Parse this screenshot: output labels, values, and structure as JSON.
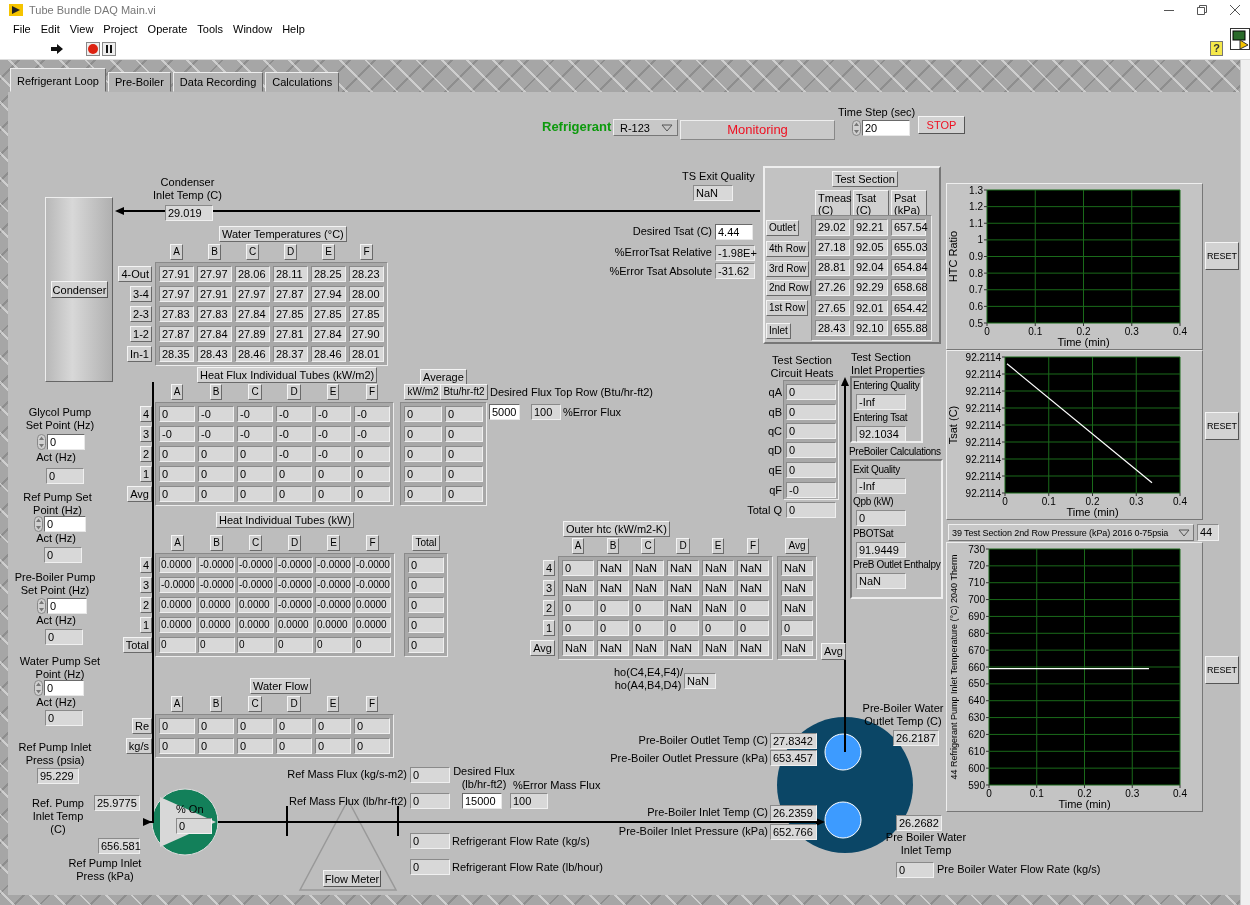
{
  "window": {
    "title": "Tube Bundle DAQ Main.vi"
  },
  "menu": [
    "File",
    "Edit",
    "View",
    "Project",
    "Operate",
    "Tools",
    "Window",
    "Help"
  ],
  "toolbar": {
    "help": "?"
  },
  "tabs": [
    {
      "label": "Refrigerant Loop",
      "selected": true
    },
    {
      "label": "Pre-Boiler",
      "selected": false
    },
    {
      "label": "Data Recording",
      "selected": false
    },
    {
      "label": "Calculations",
      "selected": false
    }
  ],
  "header": {
    "refrigerant_label": "Refrigerant",
    "refrigerant": "R-123",
    "status": "Monitoring",
    "stop_button": "STOP"
  },
  "fields": [
    {
      "label": "Time Step (sec)",
      "value": "20",
      "kind": "spin"
    },
    {
      "label": "TS Exit Quality",
      "value": "NaN",
      "kind": "indicator"
    },
    {
      "label": "Condenser Inlet Temp (C)",
      "value": "29.019",
      "kind": "indicator"
    },
    {
      "label": "Desired Tsat (C)",
      "value": "4.44",
      "kind": "control"
    },
    {
      "label": "%ErrorTsat Relative",
      "value": "-1.98E+",
      "kind": "indicator"
    },
    {
      "label": "%Error Tsat Absolute",
      "value": "-31.62",
      "kind": "indicator"
    },
    {
      "label": "Desired Flux Top Row (Btu/hr-ft2)",
      "value": "5000",
      "kind": "control"
    },
    {
      "label": "ho(C4,E4,F4)/ ho(A4,B4,D4)",
      "value": "NaN",
      "kind": "indicator"
    },
    {
      "label": "Pre-Boiler Water Outlet Temp (C)",
      "value": "26.2187",
      "kind": "indicator"
    },
    {
      "label": "Pre-Boiler Outlet Temp (C)",
      "value": "27.8342",
      "kind": "indicator"
    },
    {
      "label": "Pre-Boiler Outlet Pressure (kPa)",
      "value": "653.457",
      "kind": "indicator"
    },
    {
      "label": "Ref Mass Flux (kg/s-m2)",
      "value": "0",
      "kind": "indicator"
    },
    {
      "label": "Ref Mass Flux (lb/hr-ft2)",
      "value": "0",
      "kind": "indicator"
    },
    {
      "label": "Desired Flux (lb/hr-ft2)",
      "value": "15000",
      "kind": "control"
    },
    {
      "label": "%Error Mass Flux",
      "value": "100",
      "kind": "indicator"
    },
    {
      "label": "Pre-Boiler Inlet Temp (C)",
      "value": "26.2359",
      "kind": "indicator"
    },
    {
      "label": "Pre-Boiler Inlet Pressure (kPa)",
      "value": "652.766",
      "kind": "indicator"
    }
  ],
  "left_controls": [
    {
      "label": "Glycol Pump Set Point (Hz)",
      "value": "0",
      "kind": "spin"
    },
    {
      "label": "Act (Hz)",
      "value": "0",
      "kind": "indicator"
    },
    {
      "label": "Ref Pump Set Point (Hz)",
      "value": "0",
      "kind": "spin"
    },
    {
      "label": "Act (Hz)",
      "value": "0",
      "kind": "indicator"
    },
    {
      "label": "Pre-Boiler Pump Set Point (Hz)",
      "value": "0",
      "kind": "spin"
    },
    {
      "label": "Act (Hz)",
      "value": "0",
      "kind": "indicator"
    },
    {
      "label": "Water Pump Set Point (Hz)",
      "value": "0",
      "kind": "spin"
    },
    {
      "label": "Act (Hz)",
      "value": "0",
      "kind": "indicator"
    },
    {
      "label": "Ref Pump Inlet Press (psia)",
      "value": "95.229",
      "kind": "indicator"
    },
    {
      "label": "Ref. Pump Inlet Temp (C)",
      "value": "25.9775",
      "kind": "indicator"
    },
    {
      "label": "% On",
      "value": "0",
      "kind": "indicator"
    }
  ],
  "readouts": [
    {
      "value": "100",
      "caption": "%Error Flux"
    },
    {
      "value": "26.2682",
      "caption": "Pre Boiler Water Inlet Temp"
    },
    {
      "value": "656.581",
      "caption": "Ref Pump Inlet Press (kPa)"
    },
    {
      "value": "0",
      "caption": "Refrigerant Flow Rate (kg/s)"
    },
    {
      "value": "0",
      "caption": "Refrigerant Flow Rate (lb/hour)"
    },
    {
      "value": "0",
      "caption": "Pre Boiler Water Flow Rate (kg/s)"
    }
  ],
  "condenser": {
    "label": "Condenser"
  },
  "flow_meter": {
    "label": "Flow Meter"
  },
  "test_section": {
    "title": "Test Section",
    "columns": [
      "Tmeas (C)",
      "Tsat (C)",
      "Psat (kPa)"
    ],
    "rows": [
      {
        "label": "Outlet",
        "values": [
          "29.02",
          "92.21",
          "657.54"
        ]
      },
      {
        "label": "4th Row",
        "values": [
          "27.18",
          "92.05",
          "655.03"
        ]
      },
      {
        "label": "3rd Row",
        "values": [
          "28.81",
          "92.04",
          "654.84"
        ]
      },
      {
        "label": "2nd Row",
        "values": [
          "27.26",
          "92.29",
          "658.68"
        ]
      },
      {
        "label": "1st Row",
        "values": [
          "27.65",
          "92.01",
          "654.42"
        ]
      },
      {
        "label": "Inlet",
        "values": [
          "28.43",
          "92.10",
          "655.88"
        ]
      }
    ]
  },
  "tables": [
    {
      "title": "Water Temperatures (°C)",
      "columns": [
        "A",
        "B",
        "C",
        "D",
        "E",
        "F"
      ],
      "rows": [
        {
          "label": "4-Out",
          "values": [
            "27.91",
            "27.97",
            "28.06",
            "28.11",
            "28.25",
            "28.23"
          ]
        },
        {
          "label": "3-4",
          "values": [
            "27.97",
            "27.91",
            "27.97",
            "27.87",
            "27.94",
            "28.00"
          ]
        },
        {
          "label": "2-3",
          "values": [
            "27.83",
            "27.83",
            "27.84",
            "27.85",
            "27.85",
            "27.85"
          ]
        },
        {
          "label": "1-2",
          "values": [
            "27.87",
            "27.84",
            "27.89",
            "27.81",
            "27.84",
            "27.90"
          ]
        },
        {
          "label": "In-1",
          "values": [
            "28.35",
            "28.43",
            "28.46",
            "28.37",
            "28.46",
            "28.01"
          ]
        }
      ]
    },
    {
      "title": "Heat Flux Individual Tubes (kW/m2)",
      "columns": [
        "A",
        "B",
        "C",
        "D",
        "E",
        "F"
      ],
      "rows": [
        {
          "label": "4",
          "values": [
            "0",
            "-0",
            "-0",
            "-0",
            "-0",
            "-0"
          ]
        },
        {
          "label": "3",
          "values": [
            "-0",
            "-0",
            "-0",
            "-0",
            "-0",
            "-0"
          ]
        },
        {
          "label": "2",
          "values": [
            "0",
            "0",
            "0",
            "-0",
            "-0",
            "0"
          ]
        },
        {
          "label": "1",
          "values": [
            "0",
            "0",
            "0",
            "0",
            "0",
            "0"
          ]
        },
        {
          "label": "Avg",
          "values": [
            "0",
            "0",
            "0",
            "0",
            "0",
            "0"
          ]
        }
      ],
      "side": {
        "title": "Average",
        "columns": [
          "kW/m2",
          "Btu/hr-ft2"
        ],
        "rows": [
          [
            "0",
            "0"
          ],
          [
            "0",
            "0"
          ],
          [
            "0",
            "0"
          ],
          [
            "0",
            "0"
          ],
          [
            "0",
            "0"
          ]
        ]
      }
    },
    {
      "title": "Heat Individual Tubes (kW)",
      "columns": [
        "A",
        "B",
        "C",
        "D",
        "E",
        "F"
      ],
      "rows": [
        {
          "label": "4",
          "values": [
            "0.0000",
            "-0.0000",
            "-0.0000",
            "-0.0000",
            "-0.0000",
            "-0.0000"
          ]
        },
        {
          "label": "3",
          "values": [
            "-0.0000",
            "-0.0000",
            "-0.0000",
            "-0.0000",
            "-0.0000",
            "-0.0000"
          ]
        },
        {
          "label": "2",
          "values": [
            "0.0000",
            "0.0000",
            "0.0000",
            "-0.0000",
            "-0.0000",
            "0.0000"
          ]
        },
        {
          "label": "1",
          "values": [
            "0.0000",
            "0.0000",
            "0.0000",
            "0.0000",
            "0.0000",
            "0.0000"
          ]
        },
        {
          "label": "Total",
          "values": [
            "0",
            "0",
            "0",
            "0",
            "0",
            "0"
          ]
        }
      ],
      "side": {
        "columns": [
          "Total"
        ],
        "rows": [
          [
            "0"
          ],
          [
            "0"
          ],
          [
            "0"
          ],
          [
            "0"
          ],
          [
            "0"
          ]
        ]
      }
    },
    {
      "title": "Outer htc (kW/m2-K)",
      "columns": [
        "A",
        "B",
        "C",
        "D",
        "E",
        "F"
      ],
      "rows": [
        {
          "label": "4",
          "values": [
            "0",
            "NaN",
            "NaN",
            "NaN",
            "NaN",
            "NaN"
          ]
        },
        {
          "label": "3",
          "values": [
            "NaN",
            "NaN",
            "NaN",
            "NaN",
            "NaN",
            "NaN"
          ]
        },
        {
          "label": "2",
          "values": [
            "0",
            "0",
            "0",
            "NaN",
            "NaN",
            "0"
          ]
        },
        {
          "label": "1",
          "values": [
            "0",
            "0",
            "0",
            "0",
            "0",
            "0"
          ]
        },
        {
          "label": "Avg",
          "values": [
            "NaN",
            "NaN",
            "NaN",
            "NaN",
            "NaN",
            "NaN"
          ]
        }
      ],
      "side": {
        "columns": [
          "Avg"
        ],
        "rows": [
          [
            "NaN"
          ],
          [
            "NaN"
          ],
          [
            "NaN"
          ],
          [
            "0"
          ],
          [
            "NaN"
          ]
        ],
        "footer": "Avg"
      }
    },
    {
      "title": "Water Flow",
      "columns": [
        "A",
        "B",
        "C",
        "D",
        "E",
        "F"
      ],
      "rows": [
        {
          "label": "Re",
          "values": [
            "0",
            "0",
            "0",
            "0",
            "0",
            "0"
          ]
        },
        {
          "label": "kg/s",
          "values": [
            "0",
            "0",
            "0",
            "0",
            "0",
            "0"
          ]
        }
      ]
    }
  ],
  "circuit_heats": {
    "title": "Test Section Circuit Heats",
    "items": [
      {
        "label": "qA",
        "value": "0"
      },
      {
        "label": "qB",
        "value": "0"
      },
      {
        "label": "qC",
        "value": "0"
      },
      {
        "label": "qD",
        "value": "0"
      },
      {
        "label": "qE",
        "value": "0"
      },
      {
        "label": "qF",
        "value": "-0"
      },
      {
        "label": "Total Q",
        "value": "0"
      }
    ]
  },
  "inlet_properties": {
    "title": "Test Section Inlet Properties",
    "items": [
      {
        "label": "Entering Quality",
        "value": "-Inf"
      },
      {
        "label": "Entering Tsat",
        "value": "92.1034"
      }
    ]
  },
  "preboiler_calculations": {
    "title": "PreBoiler Calculations",
    "items": [
      {
        "label": "Exit Quality",
        "value": "-Inf"
      },
      {
        "label": "Qpb (kW)",
        "value": "0"
      },
      {
        "label": "PBOTSat",
        "value": "91.9449"
      },
      {
        "label": "PreB Outlet Enthalpy",
        "value": "NaN"
      }
    ]
  },
  "charts": [
    {
      "reset": "RESET",
      "chart_data": {
        "type": "line",
        "grid": true,
        "xlabel": "Time (min)",
        "ylabel": "HTC Ratio",
        "xlim": [
          0,
          0.4
        ],
        "ylim": [
          0.5,
          1.3
        ],
        "xticks": [
          0,
          0.1,
          0.2,
          0.3,
          0.4
        ],
        "yticks": [
          0.5,
          0.6,
          0.7,
          0.8,
          0.9,
          1,
          1.1,
          1.2,
          1.3
        ]
      }
    },
    {
      "reset": "RESET",
      "plot": {
        "kind": "picture",
        "xlabel": "Time (min)",
        "ylabel": "Tsat (C)",
        "x_tick_labels": [
          "0",
          "0.1",
          "0.2",
          "0.3",
          "0.4"
        ],
        "y_tick_labels": [
          "92.2114",
          "92.2114",
          "92.2114",
          "92.2114",
          "92.2114",
          "92.2114",
          "92.2114",
          "92.2114",
          "92.2114"
        ]
      }
    },
    {
      "reset": "RESET",
      "selector": "39 Test Section 2nd Row Pressure (kPa) 2016 0-75psia",
      "selector_value": "44",
      "chart_data": {
        "type": "line",
        "grid": true,
        "xlabel": "Time (min)",
        "ylabel": "44 Refrigerant Pump Inlet Temperature (°C) 2040 Therm",
        "xlim": [
          0,
          0.4
        ],
        "ylim": [
          590,
          730
        ],
        "xticks": [
          0,
          0.1,
          0.2,
          0.3,
          0.4
        ],
        "yticks": [
          590,
          600,
          610,
          620,
          630,
          640,
          650,
          660,
          670,
          680,
          690,
          700,
          710,
          720,
          730
        ],
        "x": [
          0,
          0.335
        ],
        "series": [
          {
            "color": "#ffffff",
            "values": [
              659,
              659
            ]
          }
        ]
      }
    }
  ]
}
